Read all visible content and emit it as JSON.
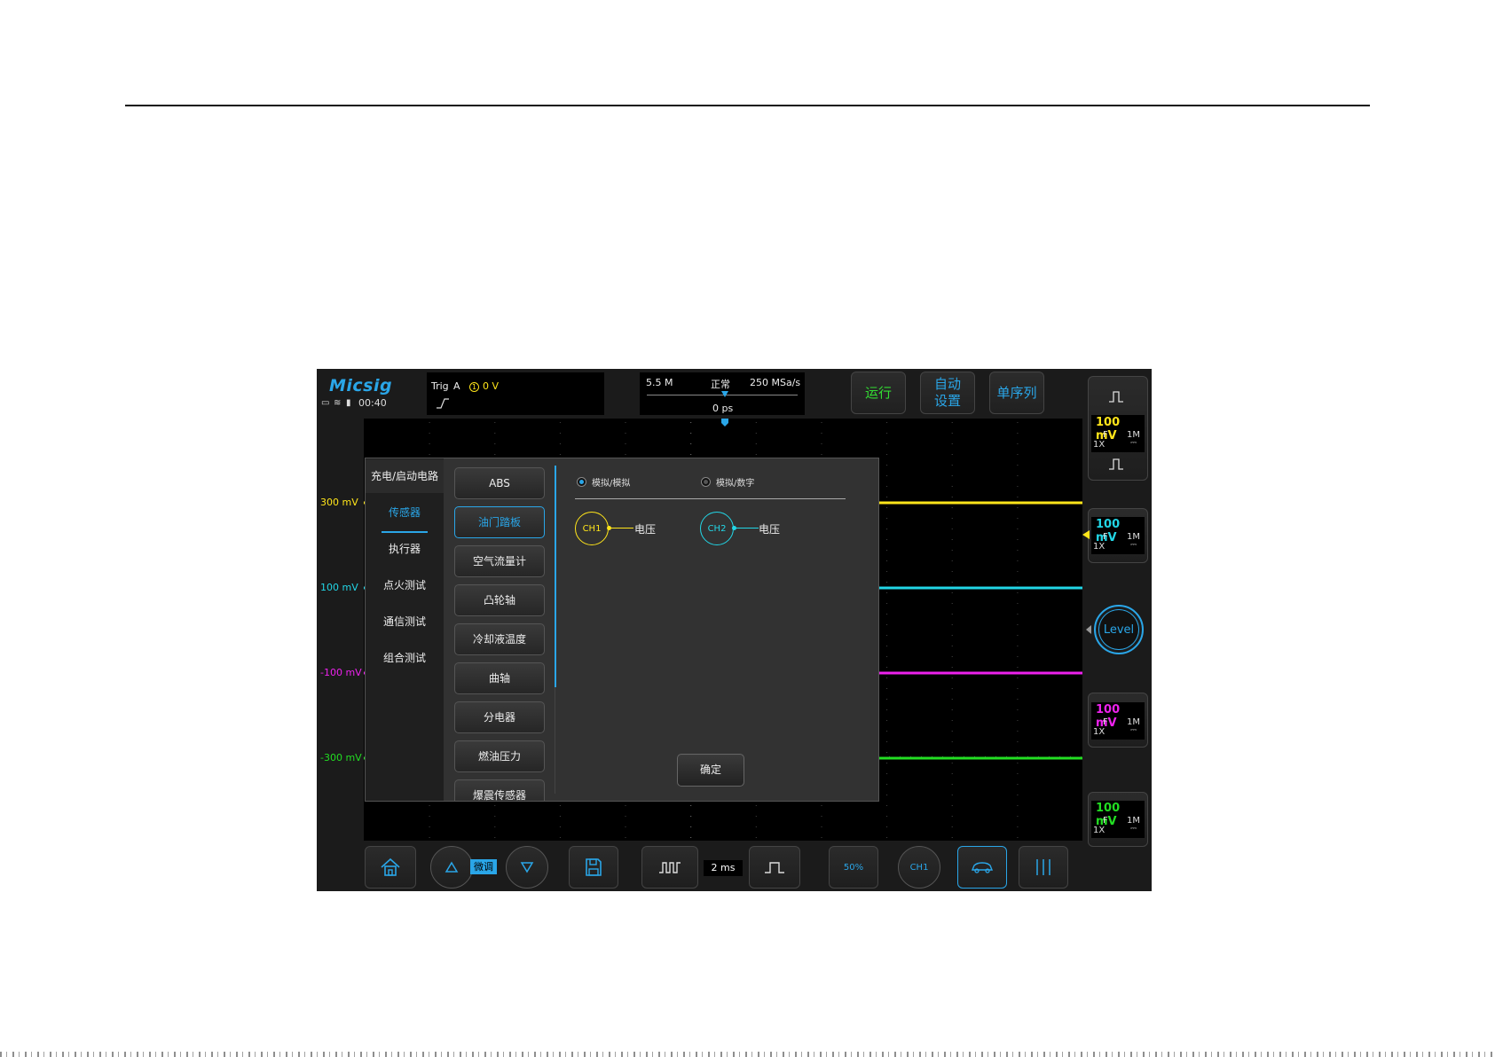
{
  "header": {
    "logo": "Micsig",
    "clock": "00:40",
    "trigger": {
      "label": "Trig",
      "source": "A",
      "channel_num": "1",
      "level": "0 V"
    },
    "timebase": {
      "memory_depth": "5.5 M",
      "acq_mode": "正常",
      "sample_rate": "250 MSa/s",
      "offset": "0 ps"
    },
    "buttons": {
      "run": "运行",
      "auto_line1": "自动",
      "auto_line2": "设置",
      "single": "单序列"
    }
  },
  "channels": [
    {
      "scale": "100 mV",
      "coupling": "F",
      "impedance": "1M",
      "probe": "1X",
      "color": "#ffe51a",
      "offset_label": "300 mV"
    },
    {
      "scale": "100 mV",
      "coupling": "F",
      "impedance": "1M",
      "probe": "1X",
      "color": "#22d6e6",
      "offset_label": "100 mV"
    },
    {
      "scale": "100 mV",
      "coupling": "F",
      "impedance": "1M",
      "probe": "1X",
      "color": "#ee22ee",
      "offset_label": "-100 mV"
    },
    {
      "scale": "100 mV",
      "coupling": "F",
      "impedance": "1M",
      "probe": "1X",
      "color": "#22dd22",
      "offset_label": "-300 mV"
    }
  ],
  "level_knob": "Level",
  "dialog": {
    "categories": [
      "充电/启动电路",
      "传感器",
      "执行器",
      "点火测试",
      "通信测试",
      "组合测试"
    ],
    "selected_category": "传感器",
    "sub_items": [
      "ABS",
      "油门踏板",
      "空气流量计",
      "凸轮轴",
      "冷却液温度",
      "曲轴",
      "分电器",
      "燃油压力",
      "爆震传感器"
    ],
    "selected_sub_item": "油门踏板",
    "modes": [
      "模拟/模拟",
      "模拟/数字"
    ],
    "selected_mode": "模拟/模拟",
    "ch1": {
      "name": "CH1",
      "measure": "电压"
    },
    "ch2": {
      "name": "CH2",
      "measure": "电压"
    },
    "ok_label": "确定"
  },
  "bottom": {
    "fine_label": "微调",
    "timebase_value": "2 ms",
    "pct_label": "50%",
    "freq_label": "CH1"
  },
  "colors": {
    "accent": "#2aa6e8",
    "run_green": "#33dd33"
  }
}
